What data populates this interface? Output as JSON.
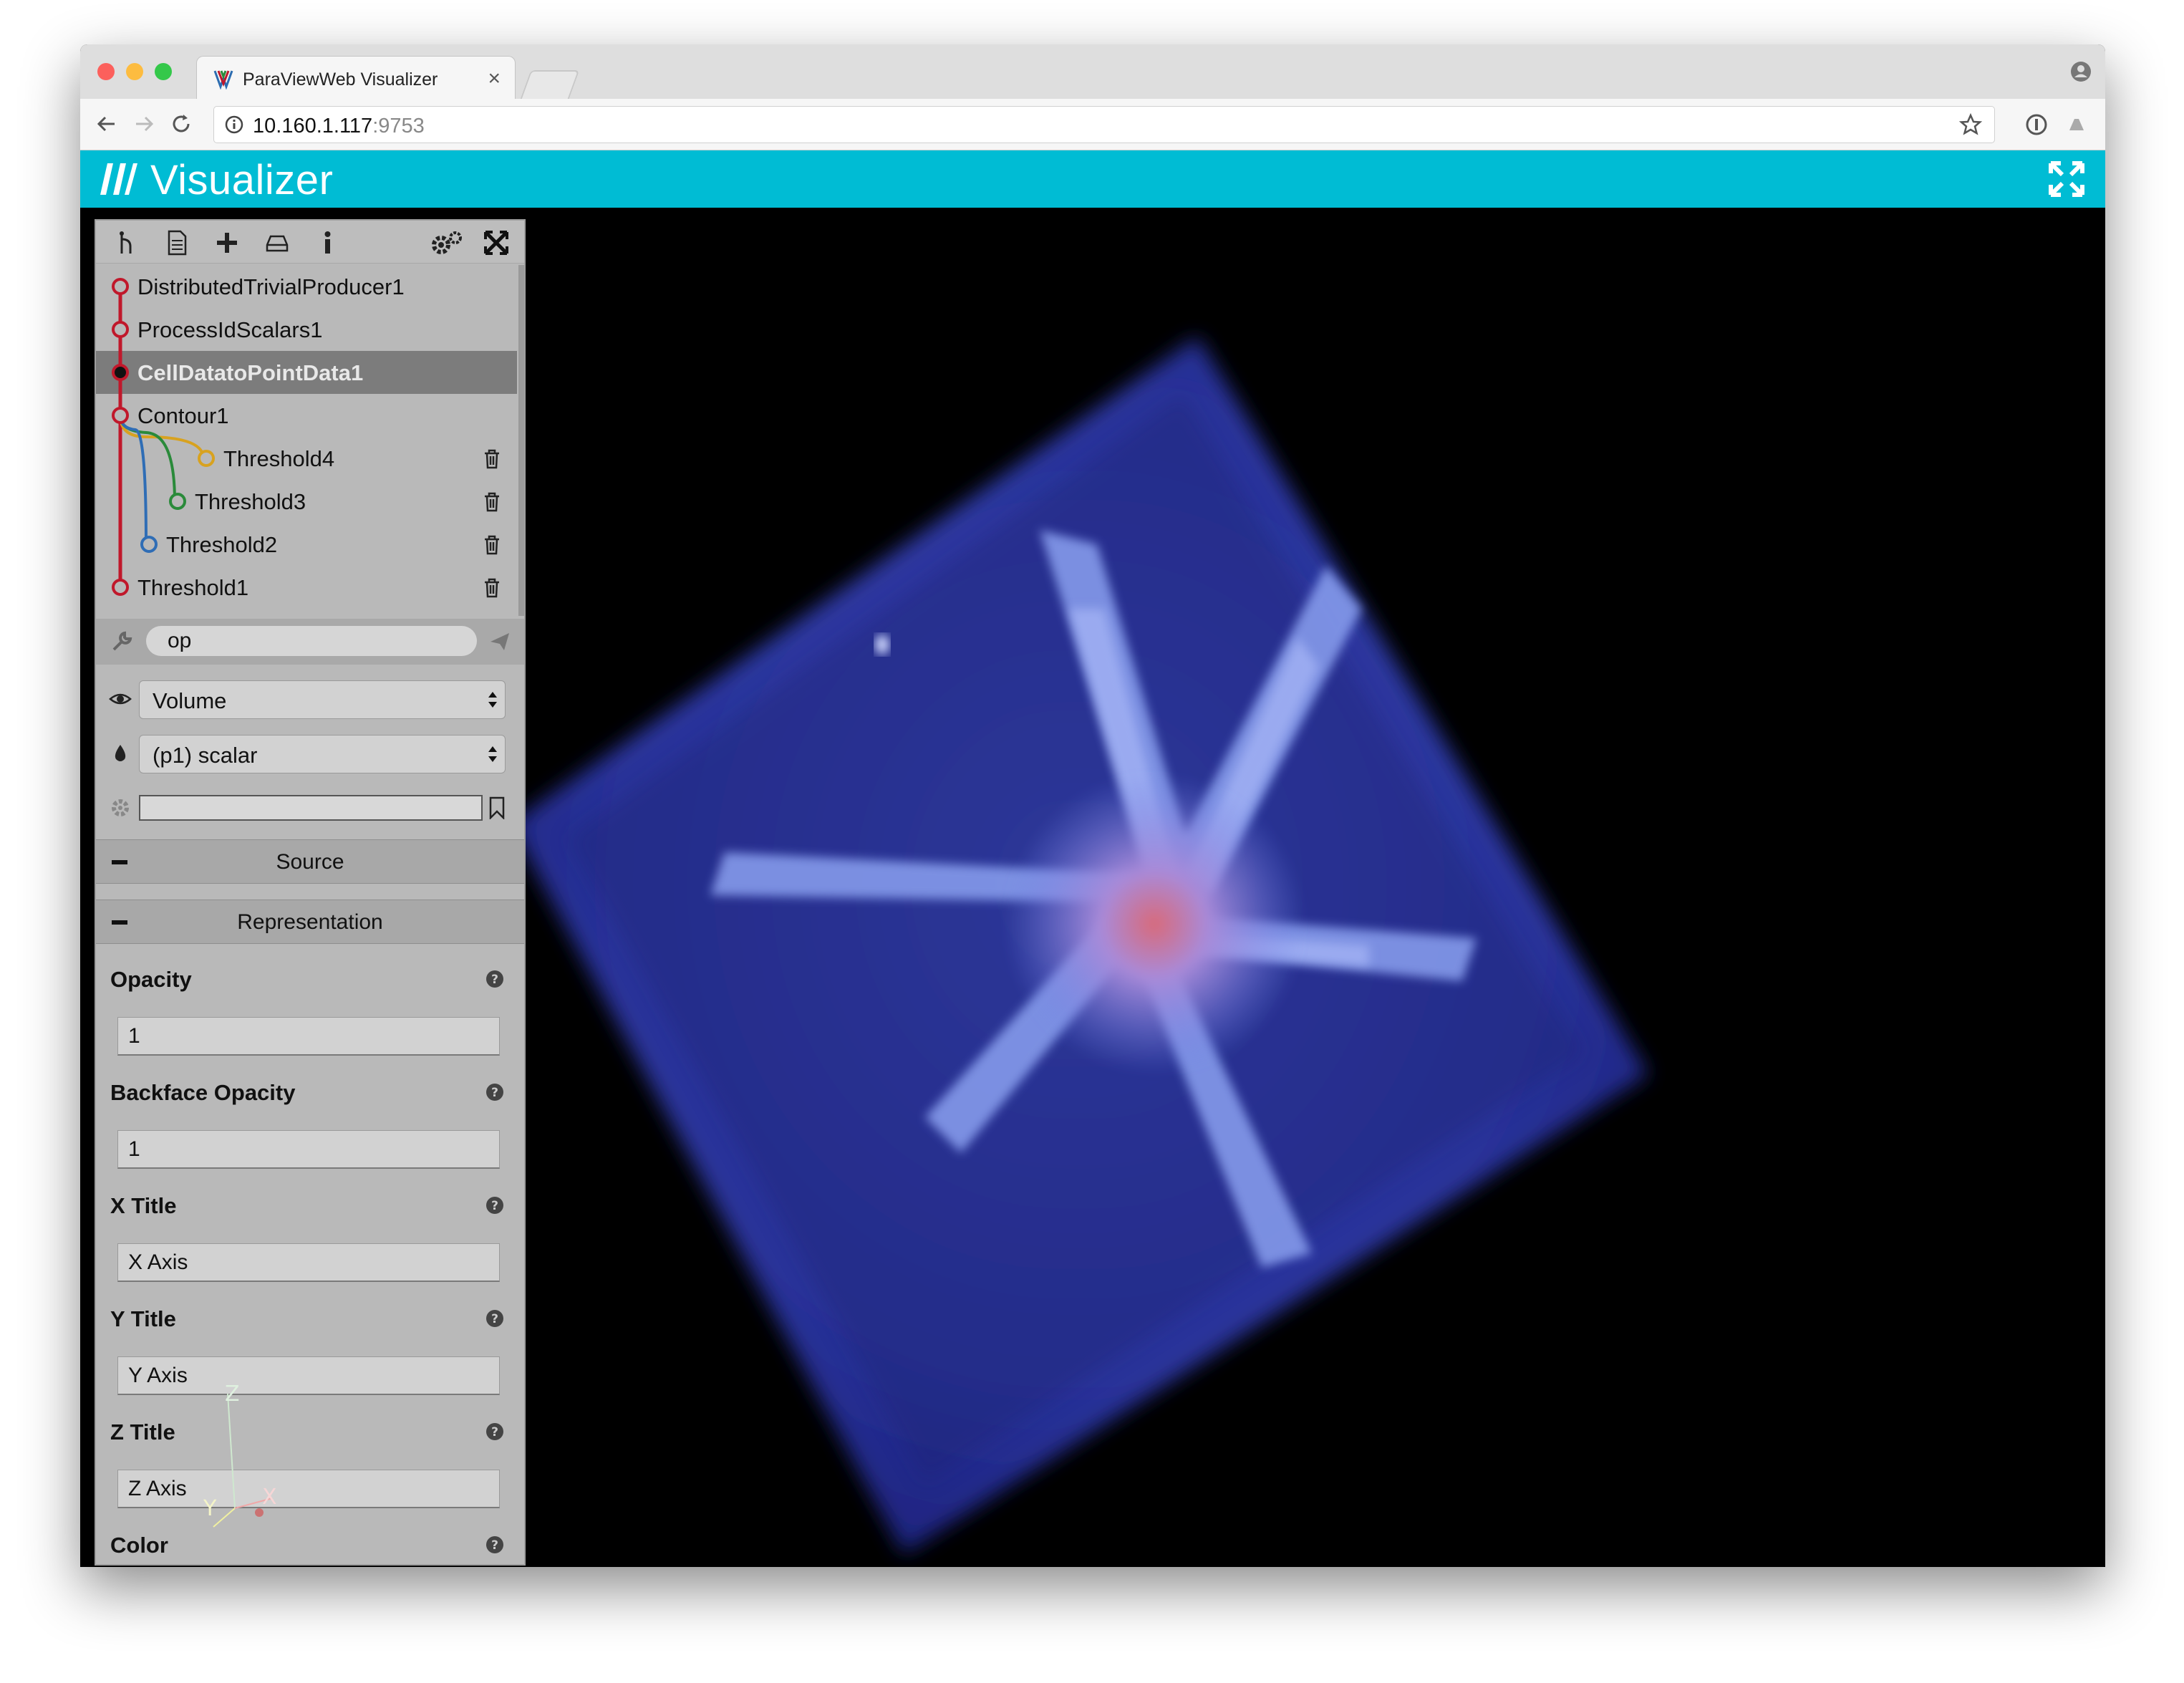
{
  "browser": {
    "tab_title": "ParaViewWeb Visualizer",
    "tab_close": "×",
    "url_host": "10.160.1.117",
    "url_port": ":9753"
  },
  "app": {
    "title": "Visualizer"
  },
  "panel": {
    "toolbar_icons": [
      "pipeline-icon",
      "file-icon",
      "add-icon",
      "save-icon",
      "info-icon",
      "settings-icon",
      "collapse-icon"
    ],
    "pipeline": [
      {
        "label": "DistributedTrivialProducer1",
        "color": "#c0182b",
        "active": false,
        "deletable": false
      },
      {
        "label": "ProcessIdScalars1",
        "color": "#c0182b",
        "active": false,
        "deletable": false
      },
      {
        "label": "CellDatatoPointData1",
        "color": "#c0182b",
        "active": true,
        "deletable": false
      },
      {
        "label": "Contour1",
        "color": "#c0182b",
        "active": false,
        "deletable": false
      },
      {
        "label": "Threshold4",
        "color": "#d8a21f",
        "active": false,
        "deletable": true
      },
      {
        "label": "Threshold3",
        "color": "#2a8a3a",
        "active": false,
        "deletable": true
      },
      {
        "label": "Threshold2",
        "color": "#2f6db5",
        "active": false,
        "deletable": true
      },
      {
        "label": "Threshold1",
        "color": "#c0182b",
        "active": false,
        "deletable": true
      }
    ],
    "search_value": "op",
    "representation_value": "Volume",
    "color_by_value": "(p1) scalar",
    "sections": {
      "source": "Source",
      "representation": "Representation"
    },
    "properties": [
      {
        "label": "Opacity",
        "value": "1"
      },
      {
        "label": "Backface Opacity",
        "value": "1"
      },
      {
        "label": "X Title",
        "value": "X Axis"
      },
      {
        "label": "Y Title",
        "value": "Y Axis"
      },
      {
        "label": "Z Title",
        "value": "Z Axis"
      },
      {
        "label": "Color",
        "value": ""
      }
    ],
    "axes": {
      "x": "X",
      "y": "Y",
      "z": "Z"
    }
  },
  "colors": {
    "header": "#00bcd4",
    "panel": "#b9b9b9",
    "volume_blue": "#3f4fc8"
  }
}
